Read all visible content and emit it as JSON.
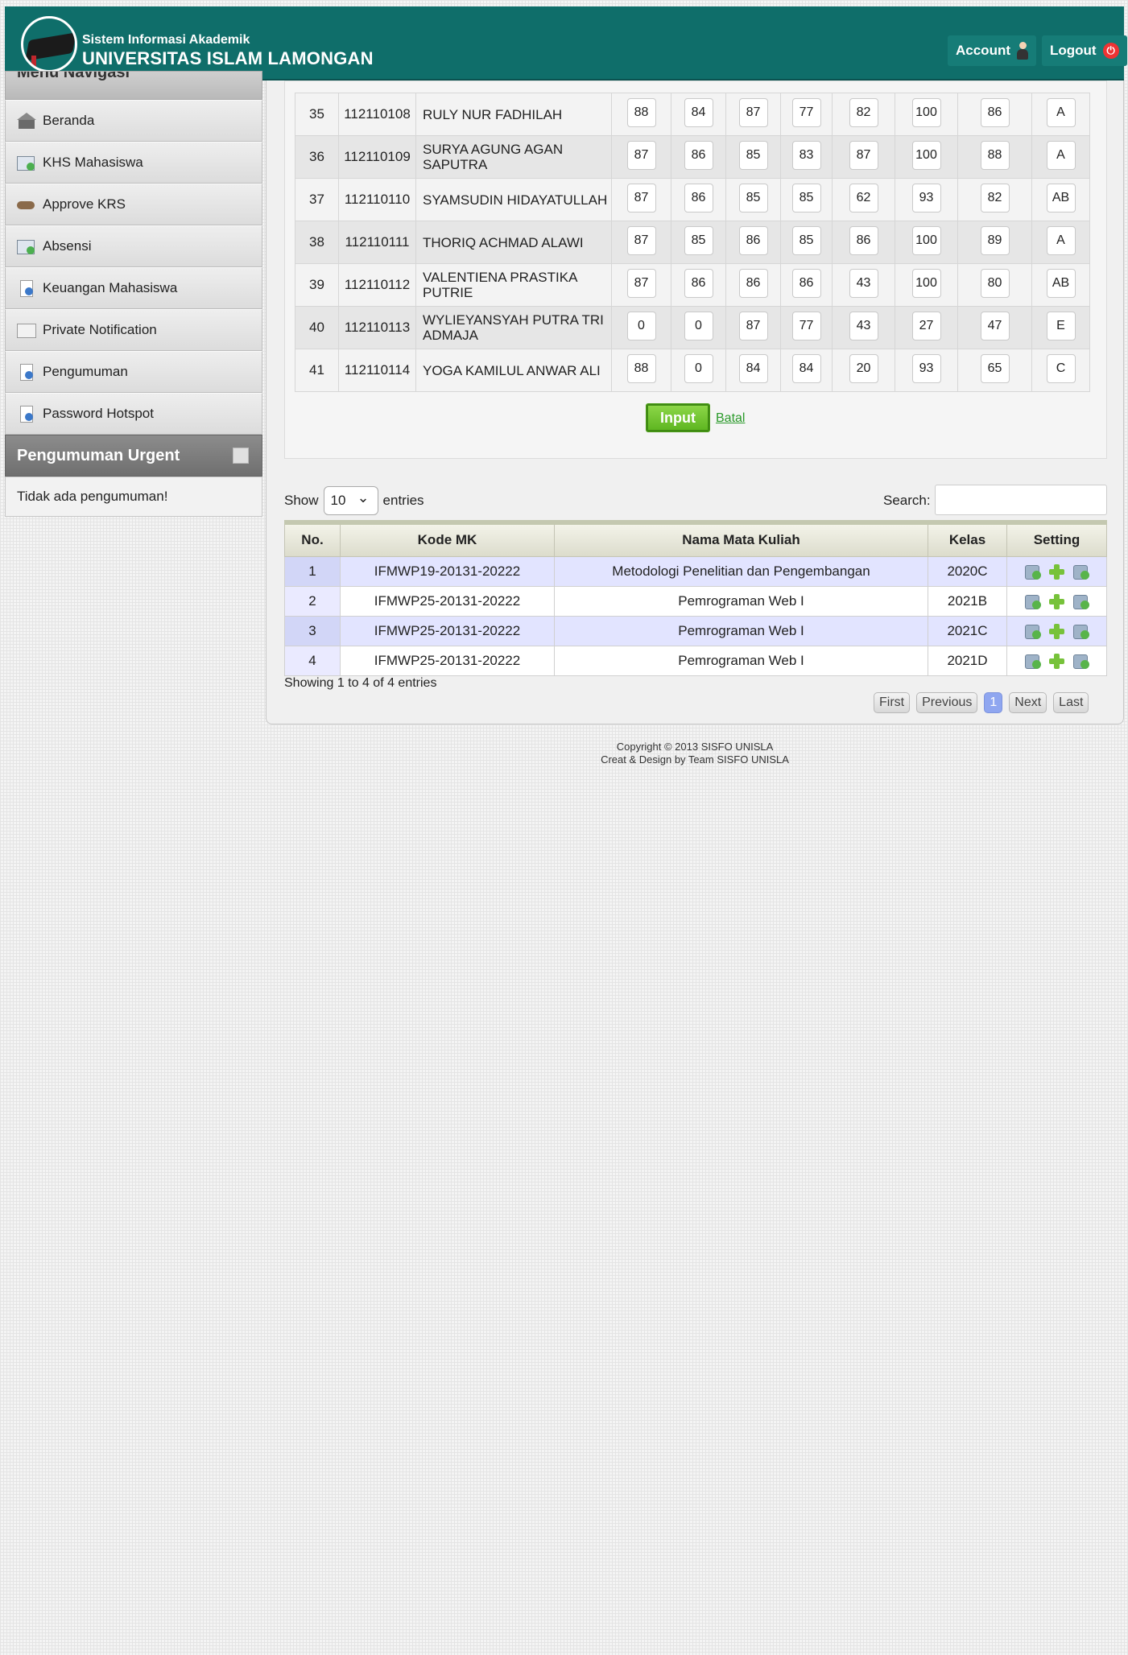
{
  "header": {
    "subtitle": "Sistem Informasi Akademik",
    "title": "UNIVERSITAS ISLAM LAMONGAN",
    "account_label": "Account",
    "logout_label": "Logout"
  },
  "sidebar": {
    "nav_title": "Menu Navigasi",
    "items": [
      {
        "label": "Beranda",
        "icon": "home-icon"
      },
      {
        "label": "KHS Mahasiswa",
        "icon": "document-icon"
      },
      {
        "label": "Approve KRS",
        "icon": "handshake-icon"
      },
      {
        "label": "Absensi",
        "icon": "document-icon"
      },
      {
        "label": "Keuangan Mahasiswa",
        "icon": "info-document-icon"
      },
      {
        "label": "Private Notification",
        "icon": "mail-icon"
      },
      {
        "label": "Pengumuman",
        "icon": "info-document-icon"
      },
      {
        "label": "Password Hotspot",
        "icon": "info-document-icon"
      }
    ],
    "urgent_title": "Pengumuman Urgent",
    "urgent_body": "Tidak ada pengumuman!"
  },
  "grades": {
    "rows": [
      {
        "no": "35",
        "nim": "112110108",
        "name": "RULY NUR FADHILAH",
        "s1": "88",
        "s2": "84",
        "s3": "87",
        "s4": "77",
        "s5": "82",
        "s6": "100",
        "total": "86",
        "grade": "A"
      },
      {
        "no": "36",
        "nim": "112110109",
        "name": "SURYA AGUNG AGAN SAPUTRA",
        "s1": "87",
        "s2": "86",
        "s3": "85",
        "s4": "83",
        "s5": "87",
        "s6": "100",
        "total": "88",
        "grade": "A"
      },
      {
        "no": "37",
        "nim": "112110110",
        "name": "SYAMSUDIN HIDAYATULLAH",
        "s1": "87",
        "s2": "86",
        "s3": "85",
        "s4": "85",
        "s5": "62",
        "s6": "93",
        "total": "82",
        "grade": "AB"
      },
      {
        "no": "38",
        "nim": "112110111",
        "name": "THORIQ ACHMAD ALAWI",
        "s1": "87",
        "s2": "85",
        "s3": "86",
        "s4": "85",
        "s5": "86",
        "s6": "100",
        "total": "89",
        "grade": "A"
      },
      {
        "no": "39",
        "nim": "112110112",
        "name": "VALENTIENA PRASTIKA PUTRIE",
        "s1": "87",
        "s2": "86",
        "s3": "86",
        "s4": "86",
        "s5": "43",
        "s6": "100",
        "total": "80",
        "grade": "AB"
      },
      {
        "no": "40",
        "nim": "112110113",
        "name": "WYLIEYANSYAH PUTRA TRI ADMAJA",
        "s1": "0",
        "s2": "0",
        "s3": "87",
        "s4": "77",
        "s5": "43",
        "s6": "27",
        "total": "47",
        "grade": "E"
      },
      {
        "no": "41",
        "nim": "112110114",
        "name": "YOGA KAMILUL ANWAR ALI",
        "s1": "88",
        "s2": "0",
        "s3": "84",
        "s4": "84",
        "s5": "20",
        "s6": "93",
        "total": "65",
        "grade": "C"
      }
    ],
    "input_label": "Input",
    "cancel_label": "Batal"
  },
  "courses": {
    "show_label": "Show",
    "entries_value": "10",
    "entries_label": "entries",
    "search_label": "Search:",
    "columns": [
      "No.",
      "Kode MK",
      "Nama Mata Kuliah",
      "Kelas",
      "Setting"
    ],
    "rows": [
      {
        "no": "1",
        "kode": "IFMWP19-20131-20222",
        "nama": "Metodologi Penelitian dan Pengembangan",
        "kelas": "2020C"
      },
      {
        "no": "2",
        "kode": "IFMWP25-20131-20222",
        "nama": "Pemrograman Web I",
        "kelas": "2021B"
      },
      {
        "no": "3",
        "kode": "IFMWP25-20131-20222",
        "nama": "Pemrograman Web I",
        "kelas": "2021C"
      },
      {
        "no": "4",
        "kode": "IFMWP25-20131-20222",
        "nama": "Pemrograman Web I",
        "kelas": "2021D"
      }
    ],
    "showing_text": "Showing 1 to 4 of 4 entries",
    "pager": {
      "first": "First",
      "previous": "Previous",
      "current": "1",
      "next": "Next",
      "last": "Last"
    }
  },
  "footer": {
    "copyright": "Copyright © 2013 SISFO UNISLA",
    "credit": "Creat & Design by Team SISFO UNISLA"
  },
  "colors": {
    "header": "#0f6e6a",
    "input_button": "#6cc52c",
    "row_highlight": "#e2e4ff"
  }
}
